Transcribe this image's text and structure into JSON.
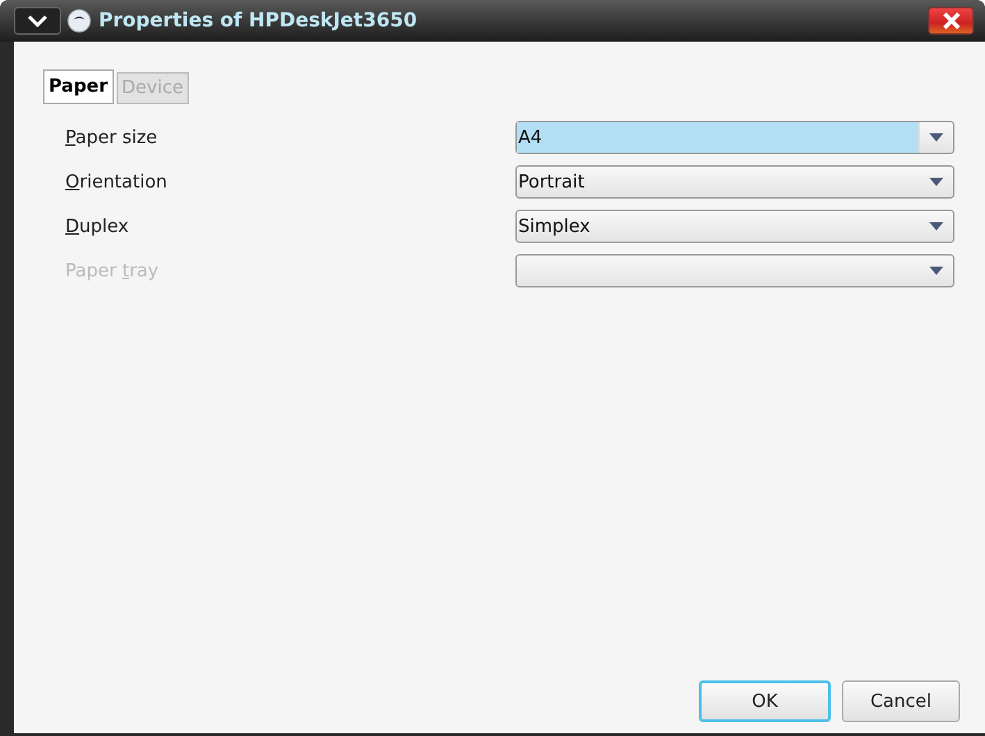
{
  "window": {
    "title": "Properties of HPDeskJet3650"
  },
  "tabs": [
    {
      "label": "Paper",
      "selected": true
    },
    {
      "label": "Device",
      "selected": false
    }
  ],
  "fields": [
    {
      "label": {
        "key": "P",
        "after": "aper size"
      },
      "value": "A4",
      "disabled": false,
      "focused": true
    },
    {
      "label": {
        "key": "O",
        "after": "rientation"
      },
      "value": "Portrait",
      "disabled": false,
      "focused": false
    },
    {
      "label": {
        "key": "D",
        "after": "uplex"
      },
      "value": "Simplex",
      "disabled": false,
      "focused": false
    },
    {
      "label": {
        "before": "Paper ",
        "key": "t",
        "after": "ray"
      },
      "disabled": true,
      "focused": false
    }
  ],
  "buttons": [
    {
      "label": "OK",
      "default": true
    },
    {
      "label": "Cancel",
      "default": false
    }
  ]
}
